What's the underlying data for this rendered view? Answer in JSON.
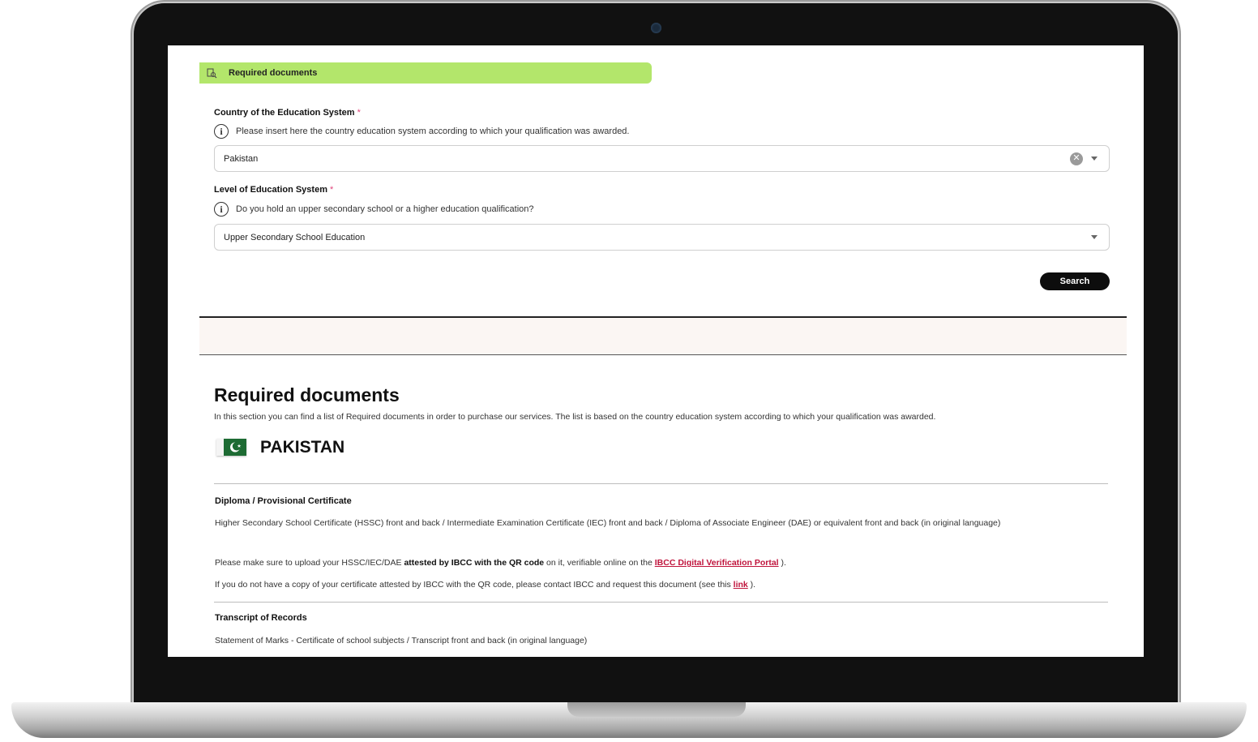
{
  "form": {
    "banner_title": "Required documents",
    "country_label": "Country of the Education System",
    "required_mark": "*",
    "country_hint": "Please insert here the country education system according to which your qualification was awarded.",
    "country_value": "Pakistan",
    "level_label": "Level of Education System",
    "level_hint": "Do you hold an upper secondary school or a higher education qualification?",
    "level_value": "Upper Secondary School Education",
    "search_label": "Search"
  },
  "results": {
    "heading": "Required documents",
    "intro": "In this section you can find a list of Required documents in order to purchase our services. The list is based on the country education system according to which your qualification was awarded.",
    "country": "PAKISTAN",
    "sections": [
      {
        "title": "Diploma / Provisional Certificate",
        "text": "Higher Secondary School Certificate (HSSC) front and back / Intermediate Examination Certificate (IEC) front and back / Diploma of Associate Engineer (DAE) or equivalent front and back (in original language)",
        "note1_pre": "Please make sure to upload your HSSC/IEC/DAE ",
        "note1_bold": "attested by IBCC with the QR code",
        "note1_mid": " on it, verifiable online on the ",
        "note1_link": "IBCC Digital Verification Portal",
        "note1_post": " ).",
        "note2_pre": "If you do not have a copy of your certificate attested by IBCC with the QR code, please contact IBCC and request this document (see this ",
        "note2_link": "link",
        "note2_post": " )."
      },
      {
        "title": "Transcript of Records",
        "text": "Statement of Marks - Certificate of school subjects / Transcript front and back (in original language)"
      }
    ]
  },
  "colors": {
    "banner": "#b3e66b",
    "required": "#e0457b",
    "link": "#c0143c",
    "flag_green": "#1d6b33"
  }
}
